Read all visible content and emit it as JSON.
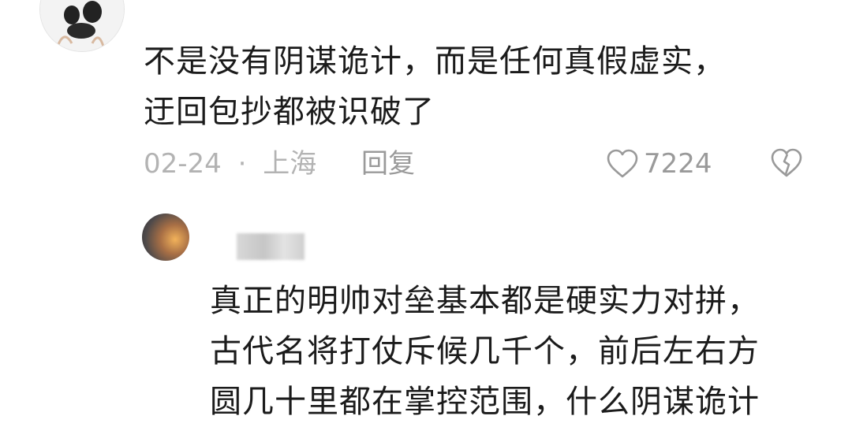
{
  "comment1": {
    "text_line1": "不是没有阴谋诡计，而是任何真假虚实，",
    "text_line2": "迂回包抄都被识破了",
    "date": "02-24",
    "separator": "·",
    "location": "上海",
    "reply_label": "回复",
    "like_count": "7224"
  },
  "comment2": {
    "lines": [
      "真正的明帅对垒基本都是硬实力对拼，",
      "古代名将打仗斥候几千个，前后左右方",
      "圆几十里都在掌控范围，什么阴谋诡计"
    ]
  },
  "icons": {
    "like": "heart-outline-icon",
    "dislike": "broken-heart-icon"
  }
}
